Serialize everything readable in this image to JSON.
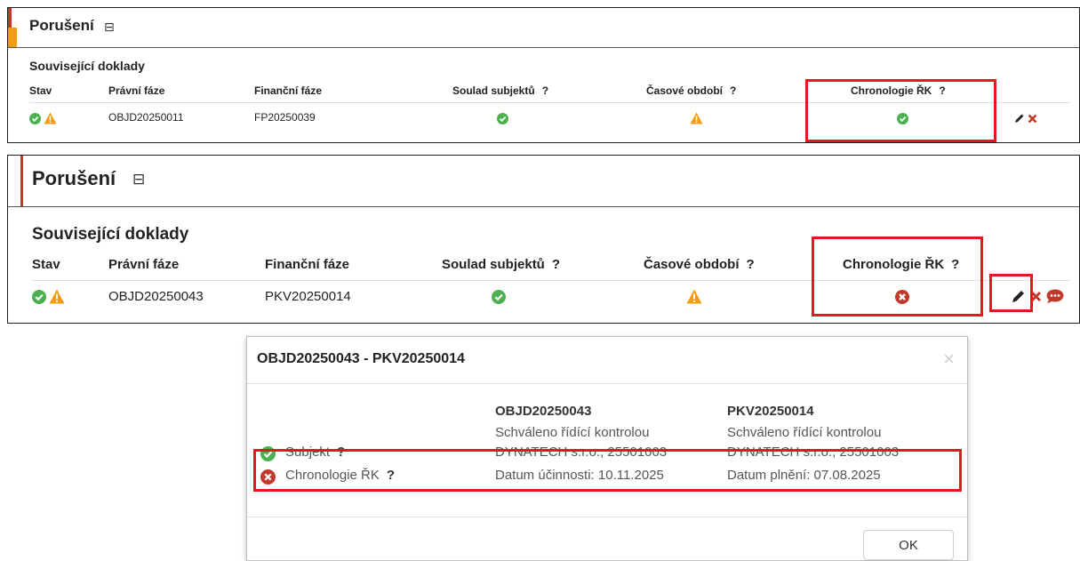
{
  "panel1": {
    "title": "Porušení",
    "collapse_icon": "collapse-icon",
    "subtitle": "Související doklady",
    "columns": [
      "Stav",
      "Právní fáze",
      "Finanční fáze",
      "Soulad subjektů",
      "Časové období",
      "Chronologie ŘK"
    ],
    "help": "?",
    "row": {
      "pravni": "OBJD20250011",
      "financni": "FP20250039",
      "chronologie": "ok"
    }
  },
  "panel2": {
    "title": "Porušení",
    "subtitle": "Související doklady",
    "columns": [
      "Stav",
      "Právní fáze",
      "Finanční fáze",
      "Soulad subjektů",
      "Časové období",
      "Chronologie ŘK"
    ],
    "help": "?",
    "row": {
      "pravni": "OBJD20250043",
      "financni": "PKV20250014",
      "chronologie": "error"
    }
  },
  "dialog": {
    "title": "OBJD20250043 - PKV20250014",
    "close": "×",
    "col1": {
      "header": "OBJD20250043",
      "status": "Schváleno řídící kontrolou",
      "subject": "DYNATECH s.r.o., 25501003",
      "date": "Datum účinnosti: 10.11.2025"
    },
    "col2": {
      "header": "PKV20250014",
      "status": "Schváleno řídící kontrolou",
      "subject": "DYNATECH s.r.o., 25501003",
      "date": "Datum plnění: 07.08.2025"
    },
    "labels": {
      "subjekt": "Subjekt",
      "chronologie": "Chronologie ŘK",
      "help": "?"
    },
    "ok": "OK"
  },
  "colors": {
    "green": "#4caf50",
    "orange": "#f39c12",
    "red": "#c0392b",
    "highlight": "#e3171e"
  }
}
